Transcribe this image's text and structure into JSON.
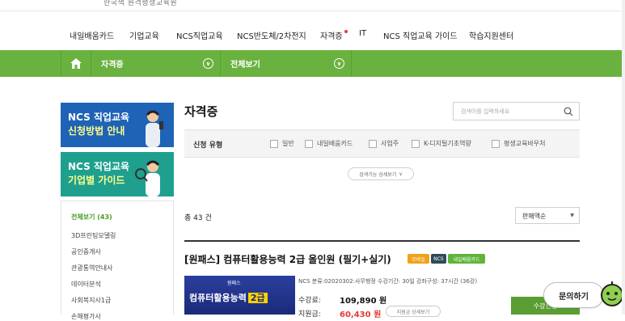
{
  "header": {
    "logo_text": "한국책 원격평생교육원"
  },
  "topnav": {
    "items": [
      "내일배움카드",
      "기업교육",
      "NCS직업교육",
      "NCS반도체/2차전지",
      "자격증",
      "IT",
      "NCS 직업교육 가이드",
      "학습지원센터"
    ],
    "active_dot_color": "#e53935"
  },
  "greenbar": {
    "category": "자격증",
    "view_all": "전체보기",
    "color": "#6ab23f"
  },
  "banners": [
    {
      "line1": "NCS 직업교육",
      "line2": "신청방법 안내",
      "color": "#1e63b5"
    },
    {
      "line1": "NCS 직업교육",
      "line2": "기업별 가이드",
      "color": "#1fa08f"
    }
  ],
  "sidebar": {
    "first": "전체보기 (43)",
    "links": [
      "3D프린팅모델링",
      "공인중개사",
      "관광통역안내사",
      "데이터분석",
      "사회복지사1급",
      "손해평가사"
    ]
  },
  "main": {
    "title": "자격증",
    "search_placeholder": "검색어를 입력하세요",
    "filter": {
      "label": "신청 유형",
      "options": [
        "일반",
        "내일배움카드",
        "사업주",
        "K-디지털기초역량",
        "평생교육바우처"
      ]
    },
    "detail_search": "검색기능 상세보기",
    "count": "총 43 건",
    "sort": "판매액순"
  },
  "course": {
    "title": "[원패스] 컴퓨터활용능력 2급 올인원 (필기+실기)",
    "badges": [
      {
        "text": "모바일",
        "color": "#f0a21b"
      },
      {
        "text": "NCS",
        "color": "#2e4a5a"
      },
      {
        "text": "내일배움카드",
        "color": "#5fb53a"
      }
    ],
    "thumb_pill": "원패스",
    "thumb_text": "컴퓨터활용능력",
    "thumb_grade": "2급",
    "meta": "NCS 분류:02020302:사무행정   수강기간: 30일   강좌구성: 37시간 (36강)",
    "fee_label": "수강료:",
    "fee": "109,890 원",
    "support_label": "지원금:",
    "support": "60,430 원",
    "support_btn": "지원금 상세보기",
    "apply": "수강신청"
  },
  "inquiry": {
    "label": "문의하기"
  }
}
